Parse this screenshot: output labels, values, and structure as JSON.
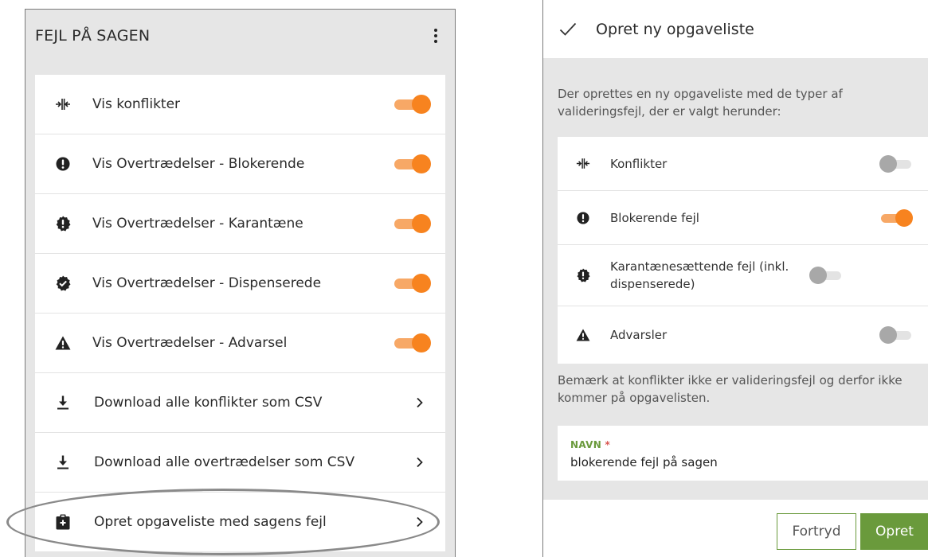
{
  "left": {
    "title": "FEJL PÅ SAGEN",
    "rows": [
      {
        "label": "Vis konflikter",
        "icon": "conflict-icon",
        "control": "toggle",
        "on": true
      },
      {
        "label": "Vis Overtrædelser - Blokerende",
        "icon": "exclamation-circle-icon",
        "control": "toggle",
        "on": true
      },
      {
        "label": "Vis Overtrædelser - Karantæne",
        "icon": "exclamation-badge-icon",
        "control": "toggle",
        "on": true
      },
      {
        "label": "Vis Overtrædelser - Dispenserede",
        "icon": "check-badge-icon",
        "control": "toggle",
        "on": true
      },
      {
        "label": "Vis Overtrædelser - Advarsel",
        "icon": "warning-triangle-icon",
        "control": "toggle",
        "on": true
      },
      {
        "label": "Download alle konflikter som CSV",
        "icon": "download-icon",
        "control": "chevron"
      },
      {
        "label": "Download alle overtrædelser som CSV",
        "icon": "download-icon",
        "control": "chevron"
      },
      {
        "label": "Opret opgaveliste med sagens fejl",
        "icon": "task-list-icon",
        "control": "chevron"
      }
    ]
  },
  "right": {
    "title": "Opret ny opgaveliste",
    "intro": "Der oprettes en ny opgaveliste med de typer af valideringsfejl, der er valgt herunder:",
    "rows": [
      {
        "label": "Konflikter",
        "icon": "conflict-icon",
        "on": false
      },
      {
        "label": "Blokerende fejl",
        "icon": "exclamation-circle-icon",
        "on": true
      },
      {
        "label": "Karantænesættende fejl (inkl. dispenserede)",
        "icon": "exclamation-badge-icon",
        "on": false
      },
      {
        "label": "Advarsler",
        "icon": "warning-triangle-icon",
        "on": false
      }
    ],
    "note": "Bemærk at konflikter ikke er valideringsfejl og derfor ikke kommer på opgavelisten.",
    "name_label": "NAVN",
    "name_required": "*",
    "name_value": "blokerende fejl på sagen",
    "cancel_label": "Fortryd",
    "create_label": "Opret"
  },
  "colors": {
    "accent": "#f7831f",
    "toggle_on_track": "#f7a866",
    "toggle_off_knob": "#a8a8a8",
    "green": "#6a9a3c",
    "panel_bg": "#e6e6e6"
  }
}
